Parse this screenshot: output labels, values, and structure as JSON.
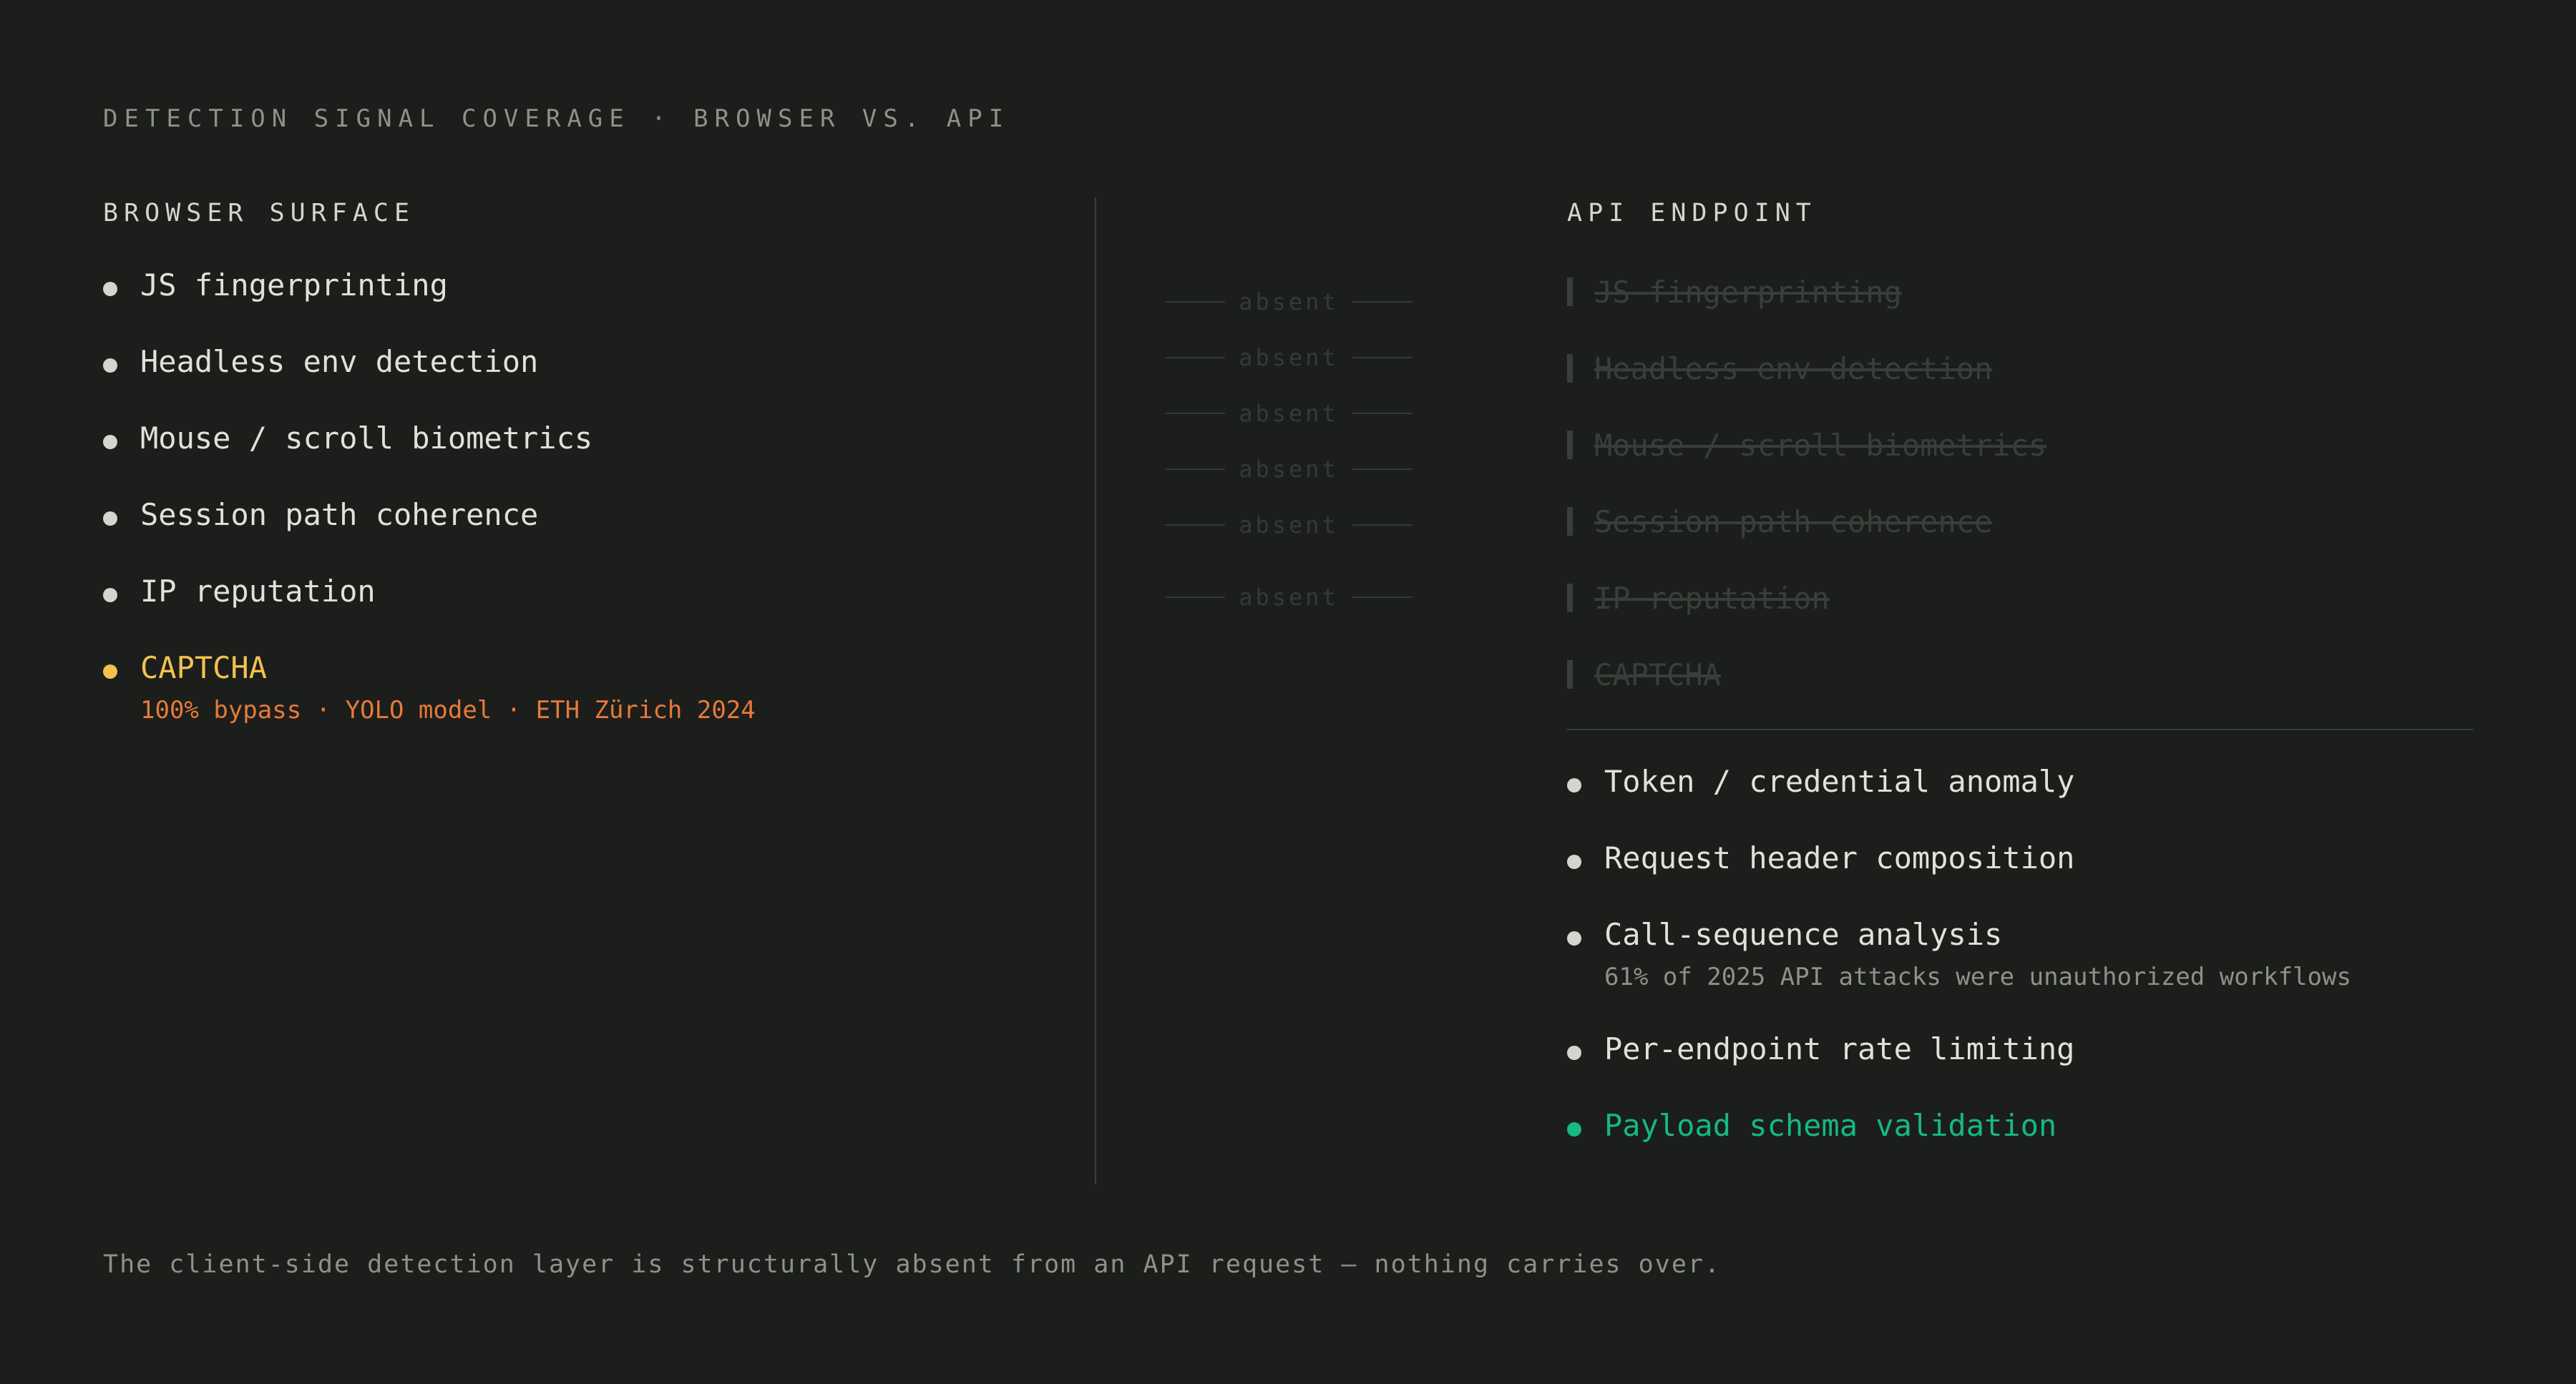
{
  "kicker": "DETECTION SIGNAL COVERAGE · BROWSER VS. API",
  "browser": {
    "title": "BROWSER SURFACE",
    "items": [
      {
        "label": "JS fingerprinting"
      },
      {
        "label": "Headless env detection"
      },
      {
        "label": "Mouse / scroll biometrics"
      },
      {
        "label": "Session path coherence"
      },
      {
        "label": "IP reputation"
      },
      {
        "label": "CAPTCHA",
        "note": "100% bypass · YOLO model · ETH Zürich 2024"
      }
    ]
  },
  "absent_label": "absent",
  "api": {
    "title": "API ENDPOINT",
    "ghost_items": [
      "JS fingerprinting",
      "Headless env detection",
      "Mouse / scroll biometrics",
      "Session path coherence",
      "IP reputation",
      "CAPTCHA"
    ],
    "items": [
      {
        "label": "Token / credential anomaly"
      },
      {
        "label": "Request header composition"
      },
      {
        "label": "Call-sequence analysis",
        "note": "61% of 2025 API attacks were unauthorized workflows"
      },
      {
        "label": "Per-endpoint rate limiting"
      },
      {
        "label": "Payload schema validation"
      }
    ]
  },
  "footer": "The client-side detection layer is structurally absent from an API request — nothing carries over.",
  "colors": {
    "background": "#1b1e1b",
    "captcha_highlight": "#f2c14e",
    "captcha_note": "#e8793a",
    "schema_highlight": "#16b883"
  }
}
